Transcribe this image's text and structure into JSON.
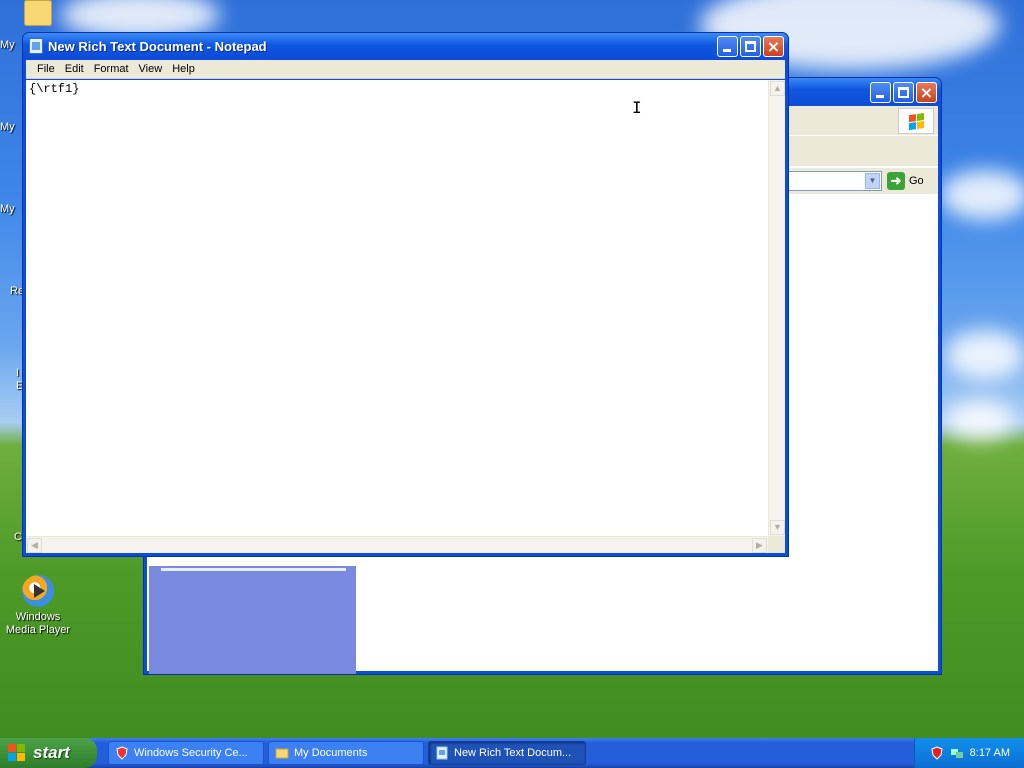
{
  "notepad": {
    "title": "New Rich Text Document - Notepad",
    "menu": [
      "File",
      "Edit",
      "Format",
      "View",
      "Help"
    ],
    "content": "{\\rtf1}"
  },
  "back_window": {
    "go_label": "Go"
  },
  "desktop": {
    "icons_partial": [
      "My",
      "My",
      "My",
      "Re",
      "I",
      "E",
      "C"
    ],
    "wmp_label": "Windows Media Player"
  },
  "taskbar": {
    "start_label": "start",
    "tasks": [
      {
        "label": "Windows Security Ce...",
        "icon": "shield-icon"
      },
      {
        "label": "My Documents",
        "icon": "folder-icon"
      },
      {
        "label": "New Rich Text Docum...",
        "icon": "notepad-icon",
        "active": true
      }
    ],
    "clock": "8:17 AM"
  },
  "colors": {
    "titlebar": "#0a4fdc",
    "start_green": "#3c8f37",
    "taskbar_blue": "#245edb",
    "tray_blue": "#0e7fe1"
  }
}
